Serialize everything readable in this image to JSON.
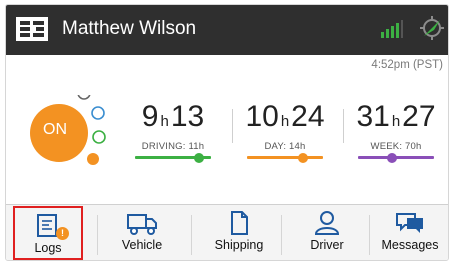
{
  "colors": {
    "header_bg": "#2f2f2f",
    "status_on": "#f39222",
    "driving": "#3cb043",
    "day": "#f39222",
    "week": "#8a4fb8",
    "nav_icon": "#1f5aa0",
    "highlight_border": "#e02020"
  },
  "header": {
    "driver_name": "Matthew Wilson",
    "icons": [
      "logo-icon",
      "signal-bars-icon",
      "gps-icon"
    ]
  },
  "time": "4:52pm (PST)",
  "status": {
    "label": "ON"
  },
  "clocks": [
    {
      "hours": "9",
      "minutes": "13",
      "unit": "h",
      "label": "DRIVING: 11h",
      "progress": 0.84
    },
    {
      "hours": "10",
      "minutes": "24",
      "unit": "h",
      "label": "DAY: 14h",
      "progress": 0.74
    },
    {
      "hours": "31",
      "minutes": "27",
      "unit": "h",
      "label": "WEEK: 70h",
      "progress": 0.45
    }
  ],
  "nav": [
    {
      "label": "Logs",
      "icon": "logs-icon",
      "badge": "!",
      "selected": true
    },
    {
      "label": "Vehicle",
      "icon": "truck-icon"
    },
    {
      "label": "Shipping",
      "icon": "document-icon"
    },
    {
      "label": "Driver",
      "icon": "person-icon"
    },
    {
      "label": "Messages",
      "icon": "chat-icon"
    }
  ]
}
